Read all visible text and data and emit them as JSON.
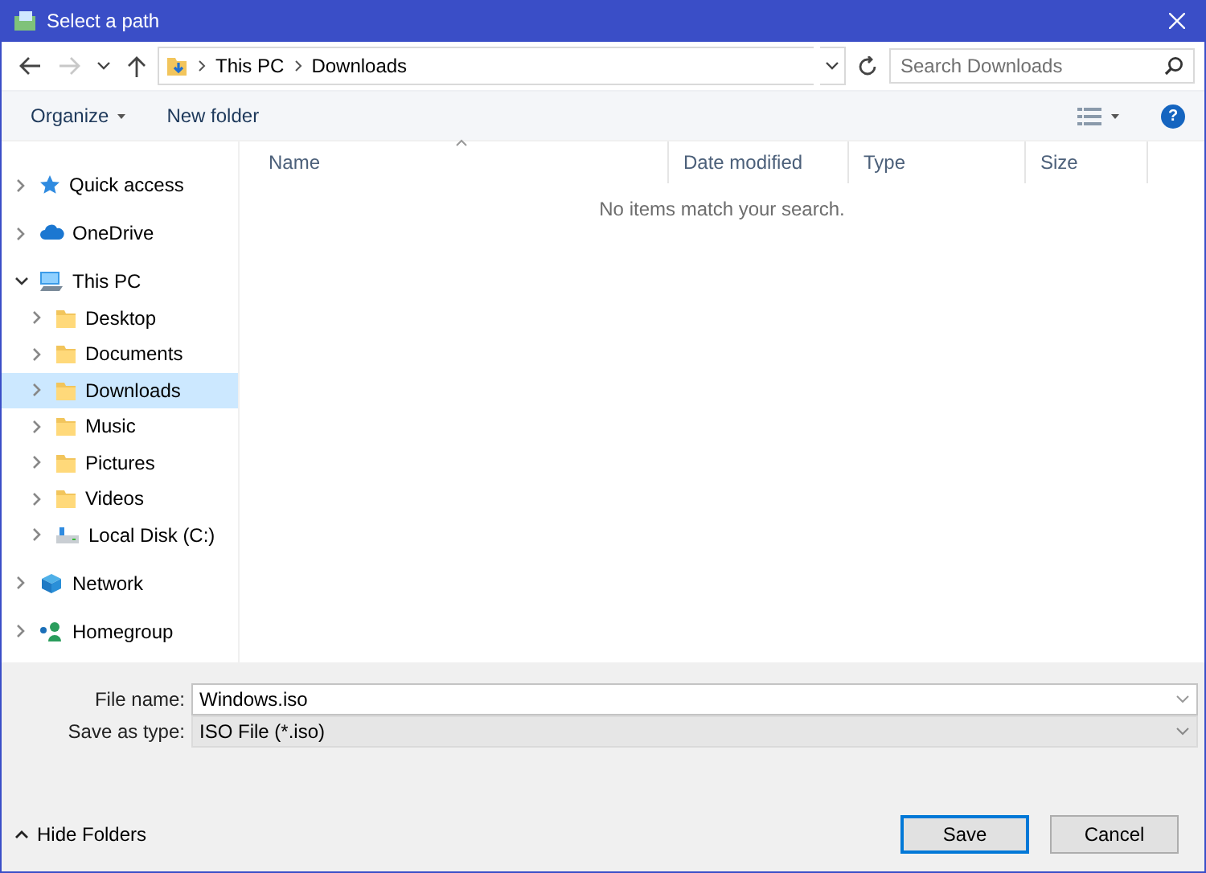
{
  "window": {
    "title": "Select a path"
  },
  "address_bar": {
    "back_disabled": false,
    "forward_disabled": true,
    "breadcrumb": [
      "This PC",
      "Downloads"
    ],
    "search": {
      "placeholder": "Search Downloads"
    }
  },
  "toolbar": {
    "organize": "Organize",
    "new_folder": "New folder",
    "help": "?"
  },
  "nav_tree": [
    {
      "label": "Quick access",
      "kind": "star",
      "expanded": false,
      "selected": false
    },
    {
      "label": "OneDrive",
      "kind": "cloud",
      "expanded": false,
      "selected": false
    },
    {
      "label": "This PC",
      "kind": "computer",
      "expanded": true,
      "selected": false,
      "children": [
        {
          "label": "Desktop",
          "kind": "folder",
          "expanded": false,
          "selected": false
        },
        {
          "label": "Documents",
          "kind": "folder",
          "expanded": false,
          "selected": false
        },
        {
          "label": "Downloads",
          "kind": "folder",
          "expanded": false,
          "selected": true
        },
        {
          "label": "Music",
          "kind": "folder",
          "expanded": false,
          "selected": false
        },
        {
          "label": "Pictures",
          "kind": "folder",
          "expanded": false,
          "selected": false
        },
        {
          "label": "Videos",
          "kind": "folder",
          "expanded": false,
          "selected": false
        },
        {
          "label": "Local Disk (C:)",
          "kind": "disk",
          "expanded": false,
          "selected": false
        }
      ]
    },
    {
      "label": "Network",
      "kind": "network",
      "expanded": false,
      "selected": false
    },
    {
      "label": "Homegroup",
      "kind": "homegroup",
      "expanded": false,
      "selected": false
    }
  ],
  "file_list": {
    "columns": [
      {
        "label": "Name",
        "sorted": true
      },
      {
        "label": "Date modified",
        "sorted": false
      },
      {
        "label": "Type",
        "sorted": false
      },
      {
        "label": "Size",
        "sorted": false
      }
    ],
    "empty_message": "No items match your search."
  },
  "footer": {
    "file_name": {
      "label": "File name:",
      "value": "Windows.iso"
    },
    "save_as_type": {
      "label": "Save as type:",
      "value": "ISO File (*.iso)"
    },
    "hide_folders": "Hide Folders",
    "buttons": [
      {
        "label": "Save",
        "default": true
      },
      {
        "label": "Cancel",
        "default": false
      }
    ]
  }
}
